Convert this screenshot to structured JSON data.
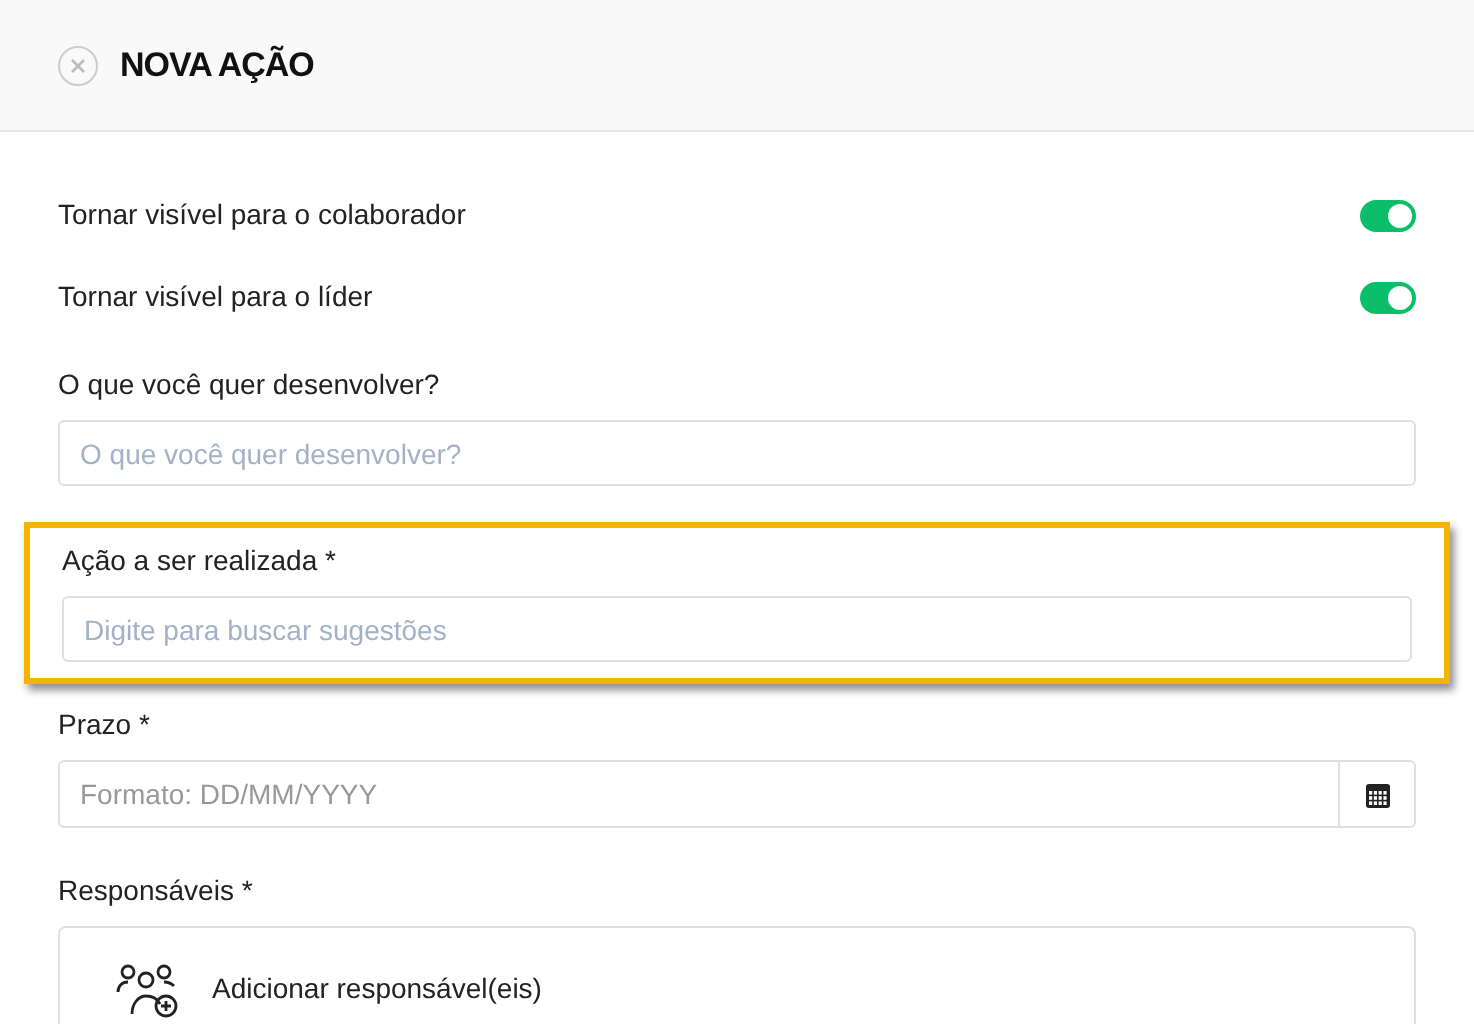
{
  "header": {
    "title": "NOVA AÇÃO"
  },
  "toggles": [
    {
      "label": "Tornar visível para o colaborador",
      "on": true
    },
    {
      "label": "Tornar visível para o líder",
      "on": true
    }
  ],
  "fields": [
    {
      "kind": "text",
      "label": "O que você quer desenvolver?",
      "placeholder": "O que você quer desenvolver?",
      "highlighted": false
    },
    {
      "kind": "text",
      "label": "Ação a ser realizada *",
      "placeholder": "Digite para buscar sugestões",
      "highlighted": true
    },
    {
      "kind": "date",
      "label": "Prazo *",
      "placeholder": "Formato: DD/MM/YYYY",
      "highlighted": false
    },
    {
      "kind": "people",
      "label": "Responsáveis *",
      "action": "Adicionar responsável(eis)",
      "highlighted": false
    }
  ]
}
